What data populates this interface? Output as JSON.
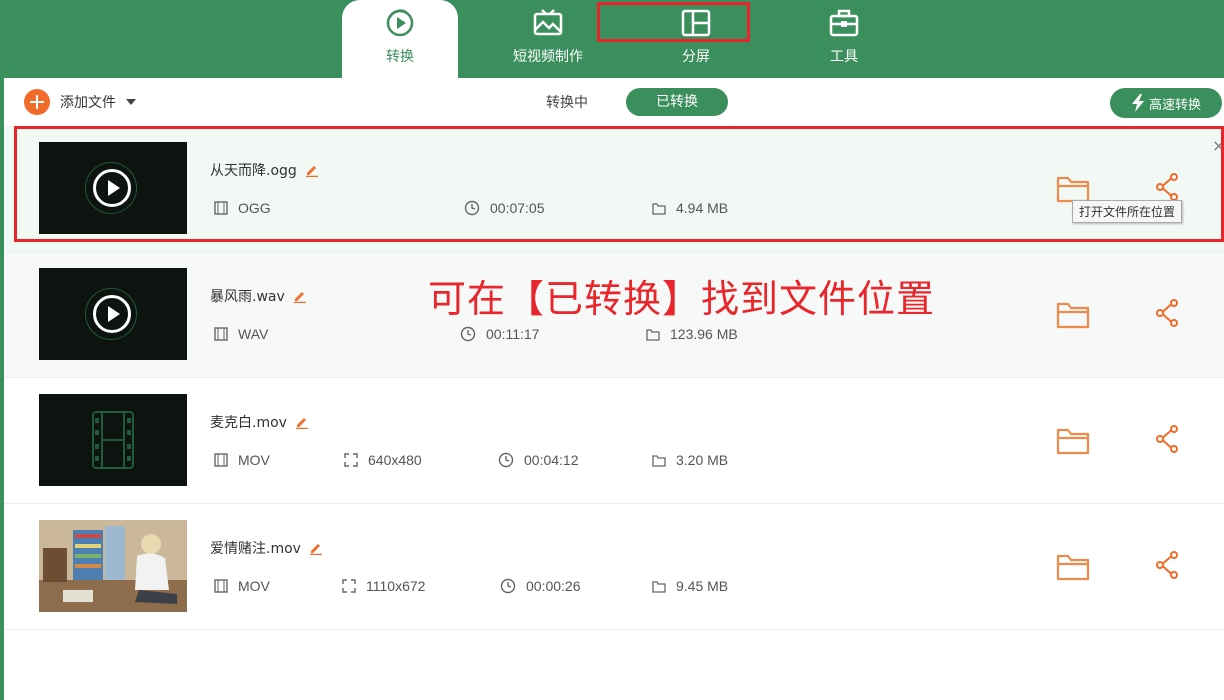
{
  "colors": {
    "brand": "#3a8f5c",
    "accent": "#f26b2a",
    "highlight": "#e8262b"
  },
  "tabs": [
    {
      "label": "转换",
      "icon": "convert-icon",
      "active": true
    },
    {
      "label": "短视频制作",
      "icon": "short-video-icon",
      "active": false
    },
    {
      "label": "分屏",
      "icon": "split-screen-icon",
      "active": false
    },
    {
      "label": "工具",
      "icon": "toolbox-icon",
      "active": false
    }
  ],
  "toolbar": {
    "add_file_label": "添加文件",
    "status_converting": "转换中",
    "status_converted": "已转换",
    "fast_convert_label": "高速转换"
  },
  "files": [
    {
      "name": "从天而降.ogg",
      "format": "OGG",
      "resolution": "",
      "duration": "00:07:05",
      "size": "4.94 MB",
      "thumb": "audio"
    },
    {
      "name": "暴风雨.wav",
      "format": "WAV",
      "resolution": "",
      "duration": "00:11:17",
      "size": "123.96 MB",
      "thumb": "audio"
    },
    {
      "name": "麦克白.mov",
      "format": "MOV",
      "resolution": "640x480",
      "duration": "00:04:12",
      "size": "3.20 MB",
      "thumb": "film"
    },
    {
      "name": "爱情赌注.mov",
      "format": "MOV",
      "resolution": "1110x672",
      "duration": "00:00:26",
      "size": "9.45 MB",
      "thumb": "scene"
    }
  ],
  "tooltip": "打开文件所在位置",
  "close_symbol": "×",
  "annotation": "可在【已转换】找到文件位置"
}
